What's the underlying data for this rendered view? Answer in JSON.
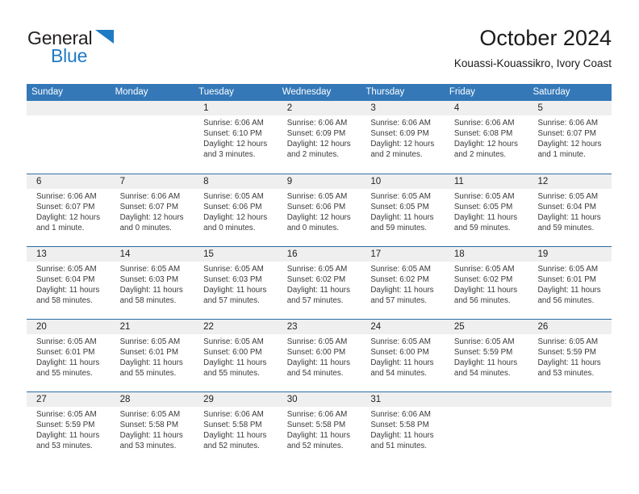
{
  "brand": {
    "logo_text_1": "General",
    "logo_text_2": "Blue",
    "logo_icon": "triangle-icon",
    "accent_color": "#1f7ac4"
  },
  "header": {
    "title": "October 2024",
    "subtitle": "Kouassi-Kouassikro, Ivory Coast"
  },
  "colors": {
    "header_blue": "#3478b8",
    "row_divider": "#2d6da3",
    "daynum_band": "#efefef"
  },
  "calendar": {
    "weekdays": [
      "Sunday",
      "Monday",
      "Tuesday",
      "Wednesday",
      "Thursday",
      "Friday",
      "Saturday"
    ],
    "weeks": [
      [
        {
          "day": "",
          "lines": []
        },
        {
          "day": "",
          "lines": []
        },
        {
          "day": "1",
          "lines": [
            "Sunrise: 6:06 AM",
            "Sunset: 6:10 PM",
            "Daylight: 12 hours",
            "and 3 minutes."
          ]
        },
        {
          "day": "2",
          "lines": [
            "Sunrise: 6:06 AM",
            "Sunset: 6:09 PM",
            "Daylight: 12 hours",
            "and 2 minutes."
          ]
        },
        {
          "day": "3",
          "lines": [
            "Sunrise: 6:06 AM",
            "Sunset: 6:09 PM",
            "Daylight: 12 hours",
            "and 2 minutes."
          ]
        },
        {
          "day": "4",
          "lines": [
            "Sunrise: 6:06 AM",
            "Sunset: 6:08 PM",
            "Daylight: 12 hours",
            "and 2 minutes."
          ]
        },
        {
          "day": "5",
          "lines": [
            "Sunrise: 6:06 AM",
            "Sunset: 6:07 PM",
            "Daylight: 12 hours",
            "and 1 minute."
          ]
        }
      ],
      [
        {
          "day": "6",
          "lines": [
            "Sunrise: 6:06 AM",
            "Sunset: 6:07 PM",
            "Daylight: 12 hours",
            "and 1 minute."
          ]
        },
        {
          "day": "7",
          "lines": [
            "Sunrise: 6:06 AM",
            "Sunset: 6:07 PM",
            "Daylight: 12 hours",
            "and 0 minutes."
          ]
        },
        {
          "day": "8",
          "lines": [
            "Sunrise: 6:05 AM",
            "Sunset: 6:06 PM",
            "Daylight: 12 hours",
            "and 0 minutes."
          ]
        },
        {
          "day": "9",
          "lines": [
            "Sunrise: 6:05 AM",
            "Sunset: 6:06 PM",
            "Daylight: 12 hours",
            "and 0 minutes."
          ]
        },
        {
          "day": "10",
          "lines": [
            "Sunrise: 6:05 AM",
            "Sunset: 6:05 PM",
            "Daylight: 11 hours",
            "and 59 minutes."
          ]
        },
        {
          "day": "11",
          "lines": [
            "Sunrise: 6:05 AM",
            "Sunset: 6:05 PM",
            "Daylight: 11 hours",
            "and 59 minutes."
          ]
        },
        {
          "day": "12",
          "lines": [
            "Sunrise: 6:05 AM",
            "Sunset: 6:04 PM",
            "Daylight: 11 hours",
            "and 59 minutes."
          ]
        }
      ],
      [
        {
          "day": "13",
          "lines": [
            "Sunrise: 6:05 AM",
            "Sunset: 6:04 PM",
            "Daylight: 11 hours",
            "and 58 minutes."
          ]
        },
        {
          "day": "14",
          "lines": [
            "Sunrise: 6:05 AM",
            "Sunset: 6:03 PM",
            "Daylight: 11 hours",
            "and 58 minutes."
          ]
        },
        {
          "day": "15",
          "lines": [
            "Sunrise: 6:05 AM",
            "Sunset: 6:03 PM",
            "Daylight: 11 hours",
            "and 57 minutes."
          ]
        },
        {
          "day": "16",
          "lines": [
            "Sunrise: 6:05 AM",
            "Sunset: 6:02 PM",
            "Daylight: 11 hours",
            "and 57 minutes."
          ]
        },
        {
          "day": "17",
          "lines": [
            "Sunrise: 6:05 AM",
            "Sunset: 6:02 PM",
            "Daylight: 11 hours",
            "and 57 minutes."
          ]
        },
        {
          "day": "18",
          "lines": [
            "Sunrise: 6:05 AM",
            "Sunset: 6:02 PM",
            "Daylight: 11 hours",
            "and 56 minutes."
          ]
        },
        {
          "day": "19",
          "lines": [
            "Sunrise: 6:05 AM",
            "Sunset: 6:01 PM",
            "Daylight: 11 hours",
            "and 56 minutes."
          ]
        }
      ],
      [
        {
          "day": "20",
          "lines": [
            "Sunrise: 6:05 AM",
            "Sunset: 6:01 PM",
            "Daylight: 11 hours",
            "and 55 minutes."
          ]
        },
        {
          "day": "21",
          "lines": [
            "Sunrise: 6:05 AM",
            "Sunset: 6:01 PM",
            "Daylight: 11 hours",
            "and 55 minutes."
          ]
        },
        {
          "day": "22",
          "lines": [
            "Sunrise: 6:05 AM",
            "Sunset: 6:00 PM",
            "Daylight: 11 hours",
            "and 55 minutes."
          ]
        },
        {
          "day": "23",
          "lines": [
            "Sunrise: 6:05 AM",
            "Sunset: 6:00 PM",
            "Daylight: 11 hours",
            "and 54 minutes."
          ]
        },
        {
          "day": "24",
          "lines": [
            "Sunrise: 6:05 AM",
            "Sunset: 6:00 PM",
            "Daylight: 11 hours",
            "and 54 minutes."
          ]
        },
        {
          "day": "25",
          "lines": [
            "Sunrise: 6:05 AM",
            "Sunset: 5:59 PM",
            "Daylight: 11 hours",
            "and 54 minutes."
          ]
        },
        {
          "day": "26",
          "lines": [
            "Sunrise: 6:05 AM",
            "Sunset: 5:59 PM",
            "Daylight: 11 hours",
            "and 53 minutes."
          ]
        }
      ],
      [
        {
          "day": "27",
          "lines": [
            "Sunrise: 6:05 AM",
            "Sunset: 5:59 PM",
            "Daylight: 11 hours",
            "and 53 minutes."
          ]
        },
        {
          "day": "28",
          "lines": [
            "Sunrise: 6:05 AM",
            "Sunset: 5:58 PM",
            "Daylight: 11 hours",
            "and 53 minutes."
          ]
        },
        {
          "day": "29",
          "lines": [
            "Sunrise: 6:06 AM",
            "Sunset: 5:58 PM",
            "Daylight: 11 hours",
            "and 52 minutes."
          ]
        },
        {
          "day": "30",
          "lines": [
            "Sunrise: 6:06 AM",
            "Sunset: 5:58 PM",
            "Daylight: 11 hours",
            "and 52 minutes."
          ]
        },
        {
          "day": "31",
          "lines": [
            "Sunrise: 6:06 AM",
            "Sunset: 5:58 PM",
            "Daylight: 11 hours",
            "and 51 minutes."
          ]
        },
        {
          "day": "",
          "lines": []
        },
        {
          "day": "",
          "lines": []
        }
      ]
    ]
  }
}
